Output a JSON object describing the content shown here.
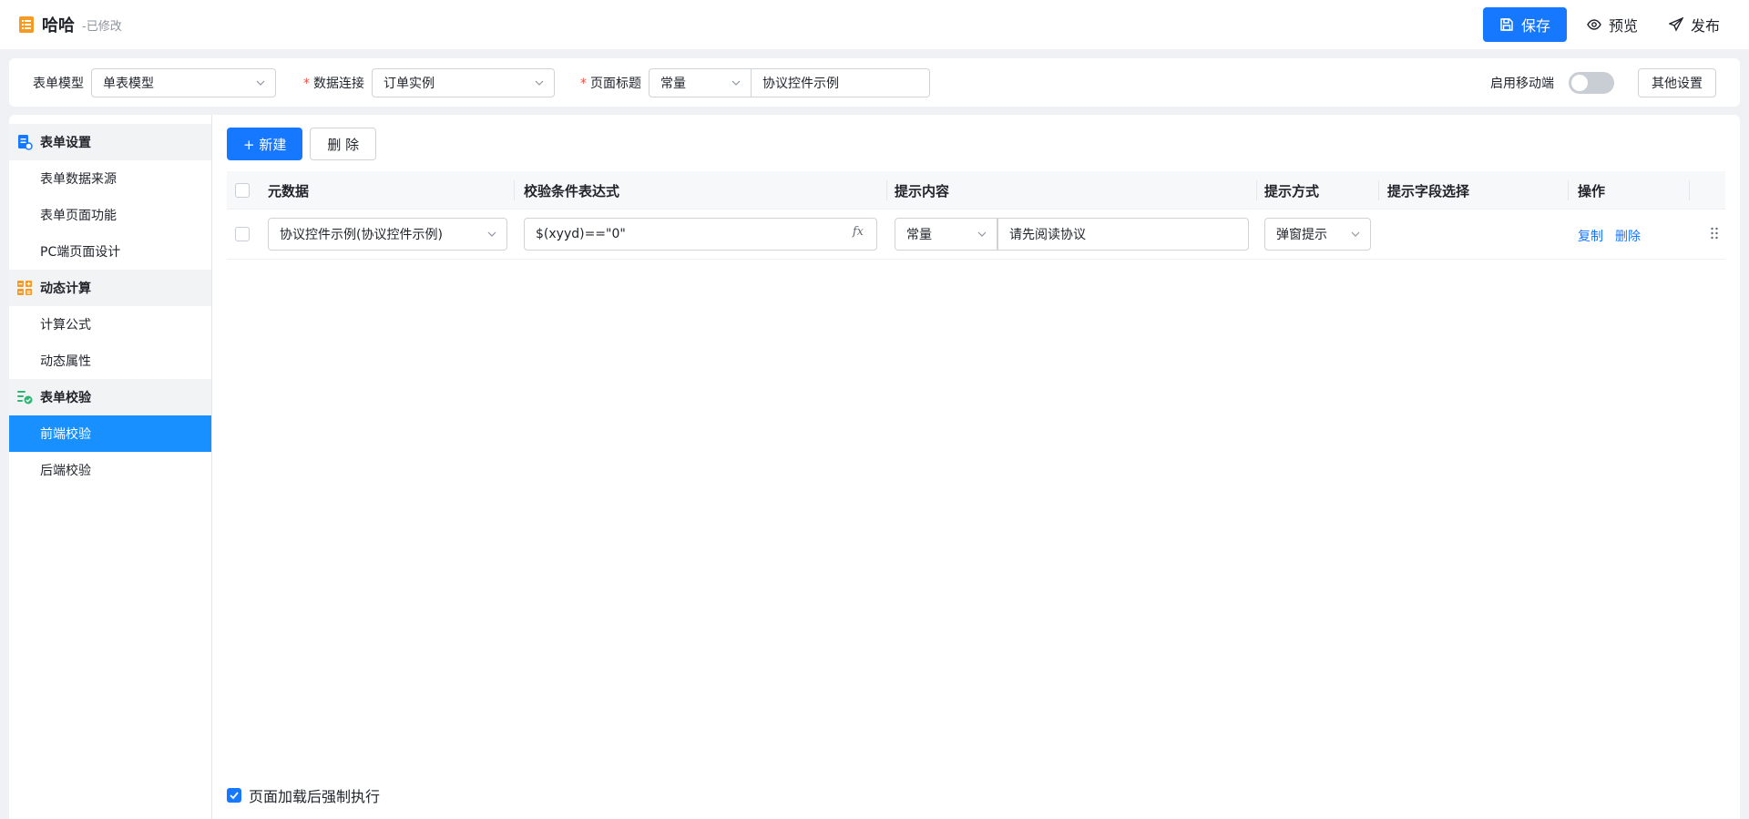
{
  "header": {
    "title": "哈哈",
    "status": "-已修改",
    "save_label": "保存",
    "preview_label": "预览",
    "publish_label": "发布"
  },
  "formbar": {
    "model_label": "表单模型",
    "model_value": "单表模型",
    "datasource_label": "数据连接",
    "datasource_value": "订单实例",
    "pagetitle_label": "页面标题",
    "pagetitle_type": "常量",
    "pagetitle_value": "协议控件示例",
    "mobile_label": "启用移动端",
    "mobile_enabled": false,
    "other_settings_label": "其他设置",
    "required_mark": "*"
  },
  "sidebar": {
    "groups": [
      {
        "label": "表单设置",
        "icon": "form-settings-icon",
        "items": [
          "表单数据来源",
          "表单页面功能",
          "PC端页面设计"
        ]
      },
      {
        "label": "动态计算",
        "icon": "calculate-icon",
        "items": [
          "计算公式",
          "动态属性"
        ]
      },
      {
        "label": "表单校验",
        "icon": "form-validate-icon",
        "items": [
          "前端校验",
          "后端校验"
        ]
      }
    ],
    "active_item": "前端校验"
  },
  "toolbar": {
    "new_label": "+ 新建",
    "delete_label": "删 除"
  },
  "table": {
    "columns": [
      "元数据",
      "校验条件表达式",
      "提示内容",
      "提示方式",
      "提示字段选择",
      "操作"
    ],
    "rows": [
      {
        "metadata": "协议控件示例(协议控件示例)",
        "expression": "$(xyyd)==\"0\"",
        "fx_label": "fx",
        "tip_type": "常量",
        "tip_content": "请先阅读协议",
        "tip_mode": "弹窗提示",
        "tip_fields": "",
        "action_copy": "复制",
        "action_delete": "删除"
      }
    ]
  },
  "footer": {
    "force_exec_label": "页面加载后强制执行",
    "force_exec_checked": true
  },
  "colors": {
    "primary": "#1677ff",
    "active_item_bg": "#1890ff",
    "required": "#f54a45",
    "brand_icon": "#f59a23"
  }
}
